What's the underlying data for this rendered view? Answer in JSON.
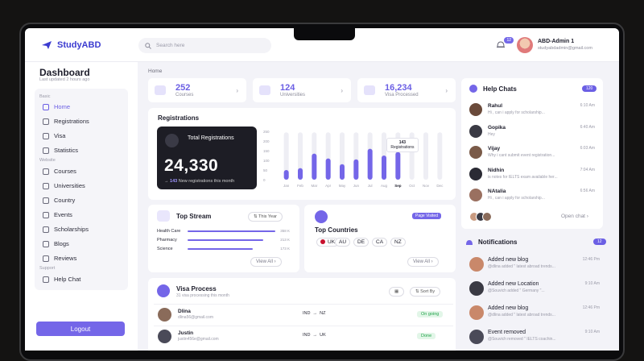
{
  "app": {
    "brand": "StudyABD",
    "search_placeholder": "Search here",
    "notif_count": "12",
    "admin_name": "ABD-Admin 1",
    "admin_email": "studyabdadmin@gmail.com"
  },
  "sidebar": {
    "title": "Dashboard",
    "updated": "Last updated 2 hours ago",
    "sec_basic": "Basic",
    "sec_website": "Website",
    "sec_support": "Support",
    "items": [
      {
        "label": "Home"
      },
      {
        "label": "Registrations"
      },
      {
        "label": "Visa"
      },
      {
        "label": "Statistics"
      },
      {
        "label": "Courses"
      },
      {
        "label": "Universities"
      },
      {
        "label": "Country"
      },
      {
        "label": "Events"
      },
      {
        "label": "Scholarships"
      },
      {
        "label": "Blogs"
      },
      {
        "label": "Reviews"
      },
      {
        "label": "Help Chat"
      }
    ],
    "logout": "Logout"
  },
  "breadcrumb": "Home",
  "stats": [
    {
      "value": "252",
      "label": "Courses"
    },
    {
      "value": "124",
      "label": "Universities"
    },
    {
      "value": "16,234",
      "label": "Visa Processed"
    }
  ],
  "registrations": {
    "title": "Registrations",
    "card_label": "Total Registrations",
    "total": "24,330",
    "new_count": "143",
    "new_text": "New registrations this month"
  },
  "chart_data": {
    "type": "bar",
    "categories": [
      "Jan",
      "Feb",
      "Mar",
      "Apr",
      "May",
      "Jun",
      "Jul",
      "Aug",
      "Sep",
      "Oct",
      "Nov",
      "Dec"
    ],
    "values": [
      50,
      60,
      135,
      110,
      80,
      105,
      160,
      125,
      143,
      0,
      0,
      0
    ],
    "max_values": [
      245,
      245,
      245,
      245,
      245,
      245,
      245,
      245,
      245,
      245,
      245,
      245
    ],
    "ylim": [
      0,
      250
    ],
    "yticks": [
      "0",
      "50",
      "100",
      "150",
      "200",
      "250"
    ],
    "highlight": "Sep",
    "highlight_label": "143",
    "highlight_sub": "Registrations",
    "accent": "#7466e8",
    "track": "#eeeef4"
  },
  "top_stream": {
    "title": "Top Stream",
    "filter": "This Year",
    "rows": [
      {
        "label": "Health Care",
        "value": "358 K",
        "pct": 0.84
      },
      {
        "label": "Pharmacy",
        "value": "213 K",
        "pct": 0.72
      },
      {
        "label": "Science",
        "value": "173 K",
        "pct": 0.62
      }
    ],
    "view_all": "View All"
  },
  "top_countries": {
    "title": "Top Countries",
    "badge": "Page Visited",
    "countries": [
      "UK",
      "AU",
      "DE",
      "CA",
      "NZ"
    ],
    "view_all": "View All"
  },
  "visa": {
    "title": "Visa Process",
    "subtitle": "31 visa processing this month",
    "sort": "Sort By",
    "rows": [
      {
        "name": "Dlina",
        "email": "dlina56@gmail.com",
        "from": "IND",
        "to": "NZ",
        "status": "On going",
        "arrow": "→"
      },
      {
        "name": "Justin",
        "email": "justin456e@gmail.com",
        "from": "IND",
        "to": "UK",
        "status": "Done",
        "arrow": "→"
      }
    ]
  },
  "help_chats": {
    "title": "Help Chats",
    "count": "120",
    "open": "Open chat",
    "items": [
      {
        "name": "Rahul",
        "msg": "Hi , can i apply for scholarship...",
        "time": "6:10 Am"
      },
      {
        "name": "Gopika",
        "msg": "Hey",
        "time": "6:40 Am"
      },
      {
        "name": "Vijay",
        "msg": "Why i cant submit event registration...",
        "time": "6:03 Am"
      },
      {
        "name": "Nidhin",
        "msg": "is notes for IELTS exam available her...",
        "time": "7:04 Am"
      },
      {
        "name": "NAtalia",
        "msg": "Hi , can i apply for scholarship...",
        "time": "6:56 Am"
      }
    ]
  },
  "notifications": {
    "title": "Notifications",
    "count": "12",
    "items": [
      {
        "title": "Added new blog",
        "sub": "@dlina added \" latest abroad trends...",
        "time": "12:46 Pm"
      },
      {
        "title": "Added new Location",
        "sub": "@Souvich added \" Germany \"...",
        "time": "9:10 Am"
      },
      {
        "title": "Added new blog",
        "sub": "@dlina added \" latest abroad trends...",
        "time": "12:46 Pm"
      },
      {
        "title": "Event removed",
        "sub": "@Souvich removed \" IELTS coachin...",
        "time": "9:10 Am"
      }
    ]
  }
}
